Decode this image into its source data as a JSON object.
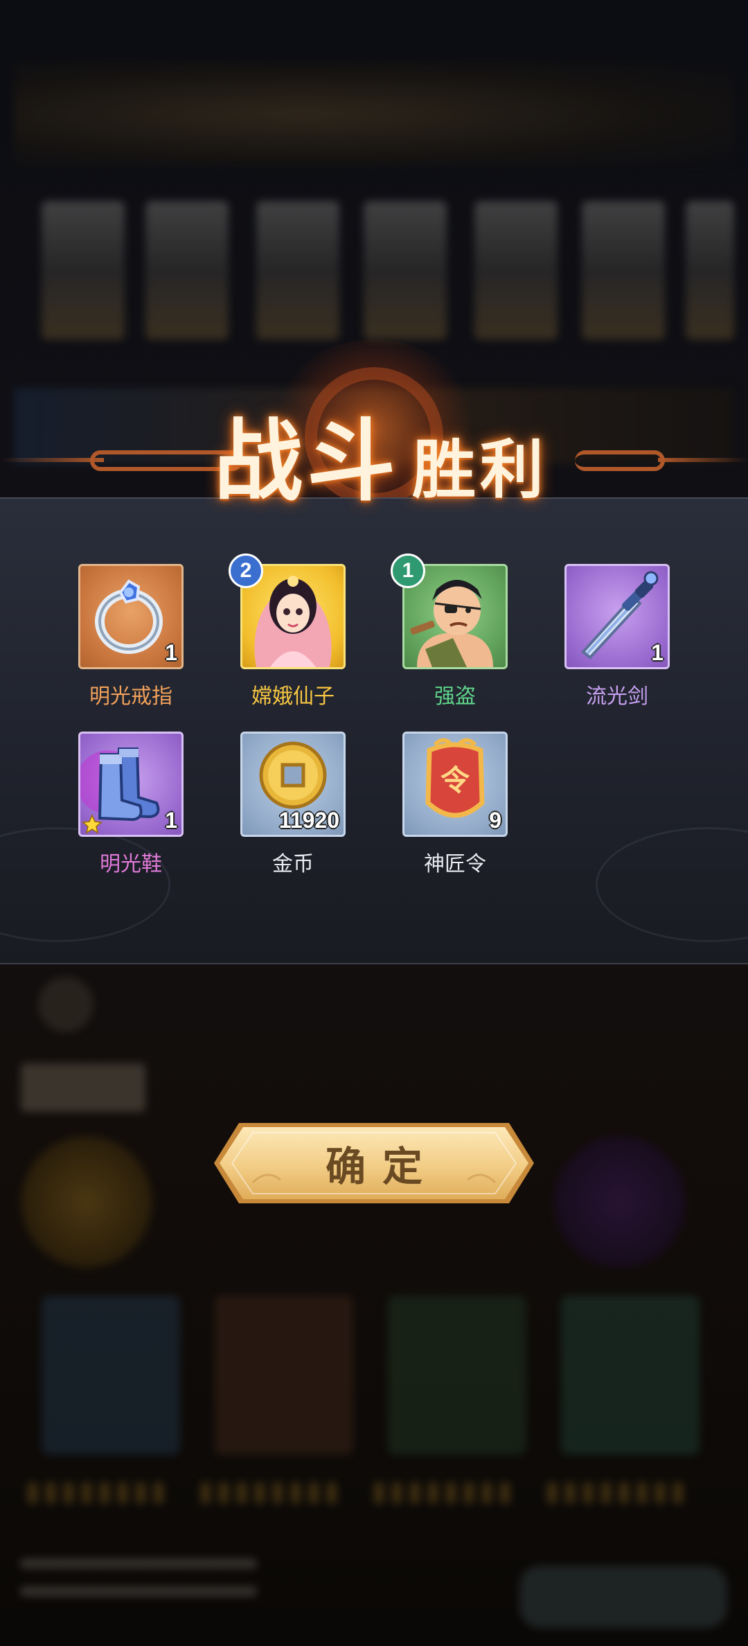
{
  "victory": {
    "title_big": "战斗",
    "title_small": "胜利"
  },
  "rewards": [
    {
      "name": "明光戒指",
      "quantity": "1",
      "rarity": "orange",
      "name_color": "#f2a15a",
      "icon": "ring-icon"
    },
    {
      "name": "嫦娥仙子",
      "level_badge": "2",
      "rarity": "gold",
      "name_color": "#f5c542",
      "icon": "change-fairy-portrait"
    },
    {
      "name": "强盗",
      "level_badge": "1",
      "rarity": "green",
      "name_color": "#5fd38a",
      "icon": "bandit-portrait"
    },
    {
      "name": "流光剑",
      "quantity": "1",
      "rarity": "purple",
      "name_color": "#c7a0f0",
      "icon": "sword-icon"
    },
    {
      "name": "明光鞋",
      "quantity": "1",
      "rarity": "purple",
      "name_color": "#e07ad8",
      "icon": "boots-icon"
    },
    {
      "name": "金币",
      "quantity": "11920",
      "rarity": "blue",
      "name_color": "#e9ecf2",
      "icon": "gold-coin-icon"
    },
    {
      "name": "神匠令",
      "quantity": "9",
      "rarity": "blue",
      "name_color": "#e9ecf2",
      "icon": "craftsman-token-icon"
    }
  ],
  "token_glyph": "令",
  "confirm": {
    "label": "确定"
  }
}
